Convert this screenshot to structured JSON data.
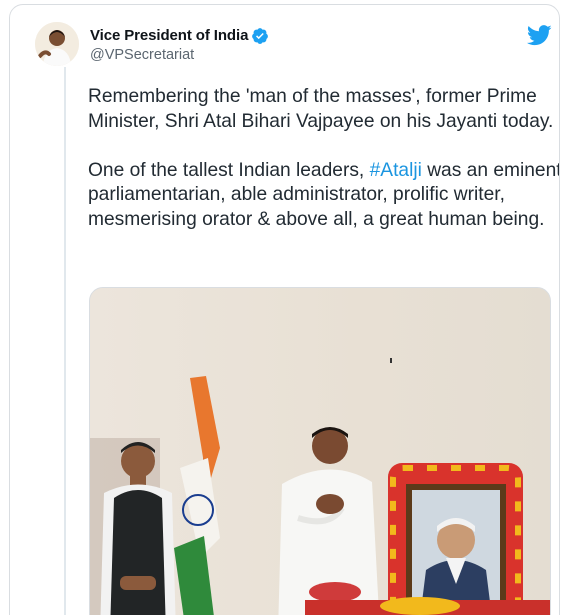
{
  "tweet": {
    "author": {
      "display_name": "Vice President of India",
      "handle": "@VPSecretariat",
      "verified": true
    },
    "text": {
      "para1": "Remembering the 'man of the masses', former Prime Minister, Shri Atal Bihari Vajpayee on his Jayanti today.",
      "para2_before": "One of the tallest Indian leaders, ",
      "hashtag": "#Atalji",
      "para2_after": " was an eminent parliamentarian, able administrator, prolific writer, mesmerising orator & above all, a great human being."
    },
    "icons": {
      "verified": "verified-badge-icon",
      "platform": "twitter-bird-icon"
    },
    "colors": {
      "link": "#1b95e0",
      "brand": "#1da1f2",
      "text": "#222b33",
      "secondary": "#5b6670"
    }
  }
}
